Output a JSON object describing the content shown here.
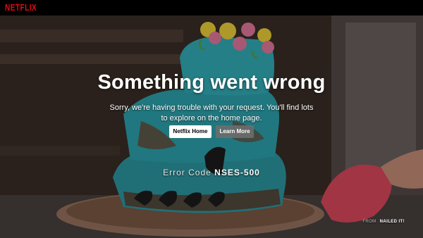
{
  "header": {
    "logo_text": "NETFLIX",
    "brand_color": "#e50914"
  },
  "error_page": {
    "title": "Something went wrong",
    "message": "Sorry, we're having trouble with your request. You'll find lots to explore on the home page.",
    "home_button_label": "Netflix Home",
    "learn_more_button_label": "Learn More",
    "error_code_label": "Error Code",
    "error_code": "NSES-500"
  },
  "background_credit": {
    "label": "FROM",
    "title": "NAILED IT!"
  },
  "colors": {
    "frosting": "#2aa7b3",
    "flower_yellow": "#f2d33a",
    "flower_pink": "#e87a9e",
    "button_primary_bg": "#ffffff",
    "button_secondary_bg": "#6d6d6e"
  }
}
